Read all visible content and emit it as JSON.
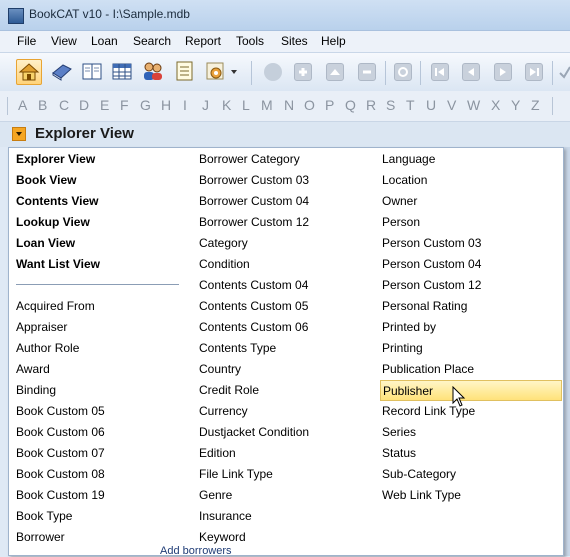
{
  "window": {
    "title": "BookCAT v10 - I:\\Sample.mdb"
  },
  "menu": [
    "File",
    "View",
    "Loan",
    "Search",
    "Report",
    "Tools",
    "Sites",
    "Help"
  ],
  "toolbar": {
    "buttons": [
      {
        "icon": "home-icon"
      },
      {
        "icon": "book-icon"
      },
      {
        "icon": "open-book-icon"
      },
      {
        "icon": "table-icon"
      },
      {
        "icon": "users-icon"
      },
      {
        "icon": "list-icon"
      },
      {
        "icon": "gear-dropdown-icon"
      },
      {
        "icon": "globe-icon"
      },
      {
        "icon": "plus-icon"
      },
      {
        "icon": "up-icon"
      },
      {
        "icon": "minus-icon"
      },
      {
        "icon": "refresh-icon"
      },
      {
        "icon": "first-icon"
      },
      {
        "icon": "prev-icon"
      },
      {
        "icon": "next-icon"
      },
      {
        "icon": "last-icon"
      },
      {
        "icon": "check-icon"
      }
    ]
  },
  "alphabet": [
    "A",
    "B",
    "C",
    "D",
    "E",
    "F",
    "G",
    "H",
    "I",
    "J",
    "K",
    "L",
    "M",
    "N",
    "O",
    "P",
    "Q",
    "R",
    "S",
    "T",
    "U",
    "V",
    "W",
    "X",
    "Y",
    "Z"
  ],
  "explorer": {
    "label": "Explorer View"
  },
  "dropdown": {
    "col1_top": [
      "Explorer View",
      "Book View",
      "Contents View",
      "Lookup View",
      "Loan View",
      "Want List View"
    ],
    "col1_bottom": [
      "Acquired From",
      "Appraiser",
      "Author Role",
      "Award",
      "Binding",
      "Book Custom 05",
      "Book Custom 06",
      "Book Custom 07",
      "Book Custom 08",
      "Book Custom 19",
      "Book Type",
      "Borrower"
    ],
    "col2": [
      "Borrower Category",
      "Borrower Custom 03",
      "Borrower Custom 04",
      "Borrower Custom 12",
      "Category",
      "Condition",
      "Contents Custom 04",
      "Contents Custom 05",
      "Contents Custom 06",
      "Contents Type",
      "Country",
      "Credit Role",
      "Currency",
      "Dustjacket Condition",
      "Edition",
      "File Link Type",
      "Genre",
      "Insurance",
      "Keyword"
    ],
    "col3": [
      "Language",
      "Location",
      "Owner",
      "Person",
      "Person Custom 03",
      "Person Custom 04",
      "Person Custom 12",
      "Personal Rating",
      "Printed by",
      "Printing",
      "Publication Place",
      "Publisher",
      "Record Link Type",
      "Series",
      "Status",
      "Sub-Category",
      "Web Link Type"
    ],
    "highlighted": "Publisher"
  },
  "background": {
    "hint": "Add borrowers"
  }
}
